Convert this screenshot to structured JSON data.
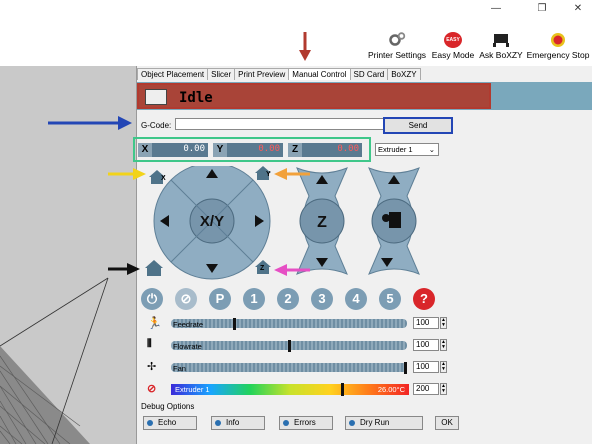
{
  "window": {
    "minimize": "—",
    "maximize": "❐",
    "close": "✕"
  },
  "toolbar": {
    "printer_settings": "Printer Settings",
    "easy_mode": "Easy Mode",
    "easy_badge": "EASY",
    "ask_boxzy": "Ask BoXZY",
    "emergency_stop": "Emergency Stop"
  },
  "tabs": [
    "Object Placement",
    "Slicer",
    "Print Preview",
    "Manual Control",
    "SD Card",
    "BoXZY"
  ],
  "active_tab": "Manual Control",
  "status": {
    "text": "Idle"
  },
  "gcode": {
    "label": "G-Code:",
    "value": "",
    "send_label": "Send"
  },
  "coords": {
    "x_label": "X",
    "x": "0.00",
    "y_label": "Y",
    "y": "0.00",
    "z_label": "Z",
    "z": "0.00"
  },
  "extruder_select": "Extruder 1",
  "jog": {
    "xy_label": "X/Y",
    "z_label": "Z",
    "home_x": "X",
    "home_y": "Y",
    "home_z": "Z"
  },
  "tool_icons": [
    "⏻",
    "⊘",
    "P",
    "1",
    "2",
    "3",
    "4",
    "5",
    "?"
  ],
  "sliders": [
    {
      "label": "Feedrate",
      "value": "100",
      "level": 0.27
    },
    {
      "label": "Flowrate",
      "value": "100",
      "level": 0.5
    },
    {
      "label": "Fan",
      "value": "100",
      "level": 1.0
    }
  ],
  "temperature": {
    "label": "Extruder 1",
    "reading": "26.00°C",
    "target": "200",
    "level": 0.72
  },
  "debug": {
    "title": "Debug Options",
    "echo": "Echo",
    "info": "Info",
    "errors": "Errors",
    "dry_run": "Dry Run",
    "ok": "OK"
  },
  "colors": {
    "status_red": "#a94438",
    "panel_blue": "#7aa8bc",
    "send_highlight": "#2346b5",
    "coords_highlight": "#3fc78a",
    "tab_highlight": "#b13a2f",
    "x_home_arrow": "#f2d31a",
    "y_home_arrow": "#f2a13a",
    "z_home_arrow": "#e64fc4",
    "all_home_arrow": "#111111",
    "gcode_arrow": "#2346b5"
  }
}
